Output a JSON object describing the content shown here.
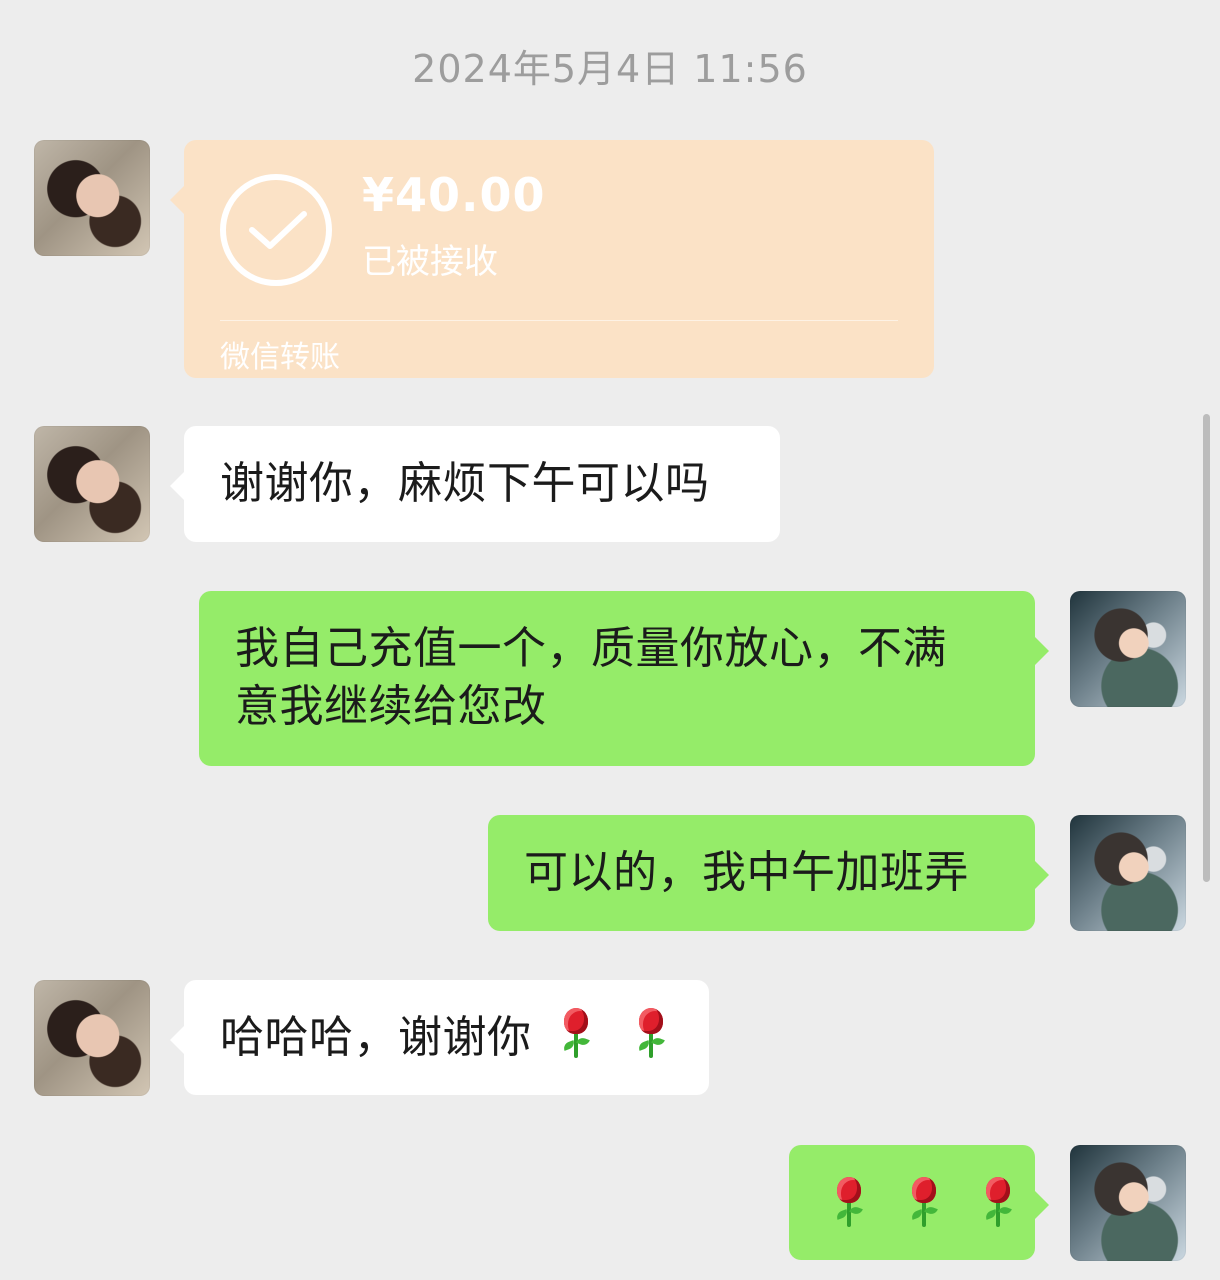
{
  "timestamp": "2024年5月4日 11:56",
  "transfer": {
    "amount": "¥40.00",
    "status": "已被接收",
    "label": "微信转账"
  },
  "messages": [
    {
      "id": 1,
      "sender": "other",
      "text": "谢谢你，麻烦下午可以吗"
    },
    {
      "id": 2,
      "sender": "me",
      "line1": "我自己充值一个，质量你放心，不满",
      "line2": "意我继续给您改"
    },
    {
      "id": 3,
      "sender": "me",
      "text": "可以的，我中午加班弄"
    },
    {
      "id": 4,
      "sender": "other",
      "text": "哈哈哈，谢谢你"
    },
    {
      "id": 5,
      "sender": "me",
      "text": ""
    }
  ],
  "icons": {
    "received_check": "check-circle-icon",
    "rose": "rose-emoji-icon"
  },
  "colors": {
    "background": "#ededed",
    "incoming_bubble": "#ffffff",
    "outgoing_bubble": "#95ec69",
    "transfer_bubble": "#fbe2c6"
  }
}
